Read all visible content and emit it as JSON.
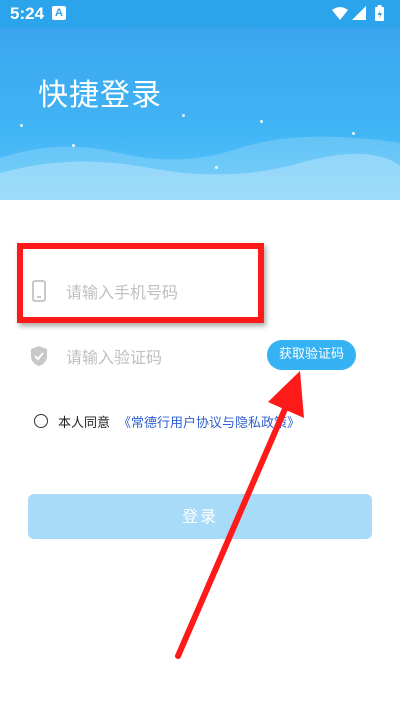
{
  "status_bar": {
    "time": "5:24",
    "notification_glyph": "A",
    "icons": [
      "wifi-icon",
      "signal-icon",
      "battery-icon"
    ]
  },
  "header": {
    "title": "快捷登录"
  },
  "form": {
    "phone_placeholder": "请输入手机号码",
    "code_placeholder": "请输入验证码",
    "get_code_label": "获取验证码"
  },
  "agreement": {
    "prefix": "本人同意",
    "link": "《常德行用户协议与隐私政策》"
  },
  "login_label": "登录",
  "colors": {
    "accent": "#34b2f3",
    "header_bg": "#41b5f5",
    "login_disabled": "#a7dbf8",
    "annotation": "#ff1a1a"
  }
}
